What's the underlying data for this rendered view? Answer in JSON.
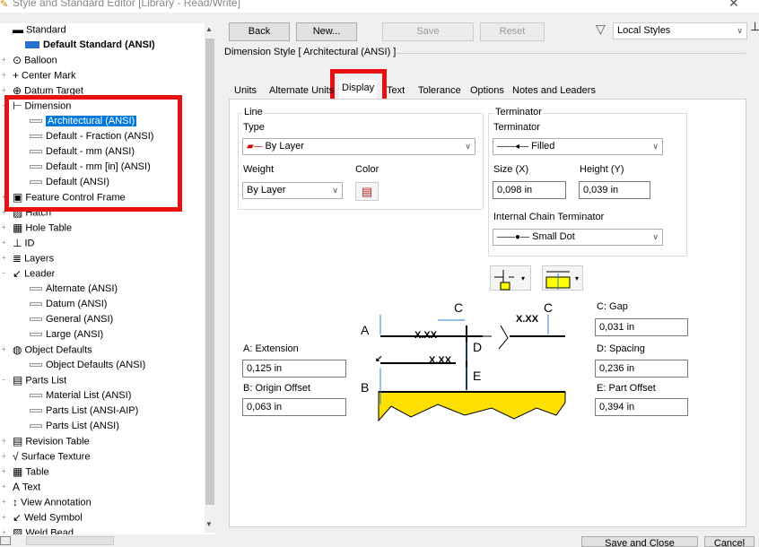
{
  "window": {
    "title": "Style and Standard Editor [Library - Read/Write]",
    "close": "✕"
  },
  "tree": {
    "items": [
      {
        "label": "Standard",
        "y": 0
      },
      {
        "label": "Default Standard (ANSI)"
      },
      {
        "label": "Balloon"
      },
      {
        "label": "Center Mark"
      },
      {
        "label": "Datum Target"
      },
      {
        "label": "Dimension"
      },
      {
        "label": "Architectural (ANSI)"
      },
      {
        "label": "Default - Fraction (ANSI)"
      },
      {
        "label": "Default - mm (ANSI)"
      },
      {
        "label": "Default - mm [in] (ANSI)"
      },
      {
        "label": "Default (ANSI)"
      },
      {
        "label": "Feature Control Frame"
      },
      {
        "label": "Hatch"
      },
      {
        "label": "Hole Table"
      },
      {
        "label": "ID"
      },
      {
        "label": "Layers"
      },
      {
        "label": "Leader"
      },
      {
        "label": "Alternate (ANSI)"
      },
      {
        "label": "Datum (ANSI)"
      },
      {
        "label": "General (ANSI)"
      },
      {
        "label": "Large (ANSI)"
      },
      {
        "label": "Object Defaults"
      },
      {
        "label": "Object Defaults (ANSI)"
      },
      {
        "label": "Parts List"
      },
      {
        "label": "Material List (ANSI)"
      },
      {
        "label": "Parts List (ANSI-AIP)"
      },
      {
        "label": "Parts List (ANSI)"
      },
      {
        "label": "Revision Table"
      },
      {
        "label": "Surface Texture"
      },
      {
        "label": "Table"
      },
      {
        "label": "Text"
      },
      {
        "label": "View Annotation"
      },
      {
        "label": "Weld Symbol"
      },
      {
        "label": "Weld Bead"
      }
    ]
  },
  "toolbar": {
    "back": "Back",
    "new": "New...",
    "save": "Save",
    "reset": "Reset",
    "filter": "Local Styles"
  },
  "style_header": "Dimension Style [ Architectural (ANSI) ]",
  "tabs": [
    "Units",
    "Alternate Units",
    "Display",
    "Text",
    "Tolerance",
    "Options",
    "Notes and Leaders"
  ],
  "line": {
    "group": "Line",
    "type_label": "Type",
    "type_value": "By Layer",
    "weight_label": "Weight",
    "weight_value": "By Layer",
    "color_label": "Color"
  },
  "terminator": {
    "group": "Terminator",
    "label": "Terminator",
    "value": "Filled",
    "size_label": "Size (X)",
    "size_value": "0,098 in",
    "height_label": "Height (Y)",
    "height_value": "0,039 in",
    "internal_label": "Internal Chain Terminator",
    "internal_value": "Small Dot"
  },
  "params": {
    "a_label": "A: Extension",
    "a_value": "0,125 in",
    "b_label": "B: Origin Offset",
    "b_value": "0,063 in",
    "c_label": "C: Gap",
    "c_value": "0,031 in",
    "d_label": "D: Spacing",
    "d_value": "0,236 in",
    "e_label": "E: Part Offset",
    "e_value": "0,394 in"
  },
  "diagram": {
    "A": "A",
    "B": "B",
    "C": "C",
    "D": "D",
    "E": "E",
    "xxx": "X.XX"
  },
  "footer": {
    "ok_partial": "Save and Close",
    "cancel": "Cancel"
  }
}
